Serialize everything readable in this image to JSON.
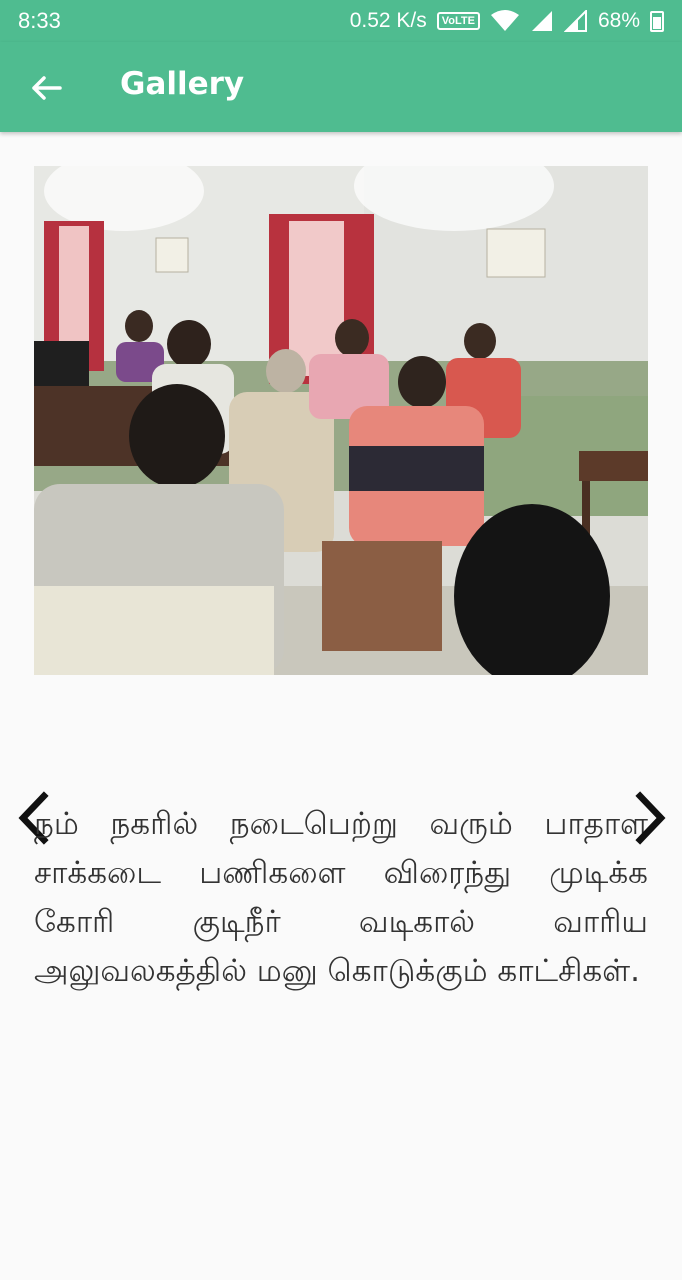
{
  "status_bar": {
    "time": "8:33",
    "net_speed": "0.52 K/s",
    "volte": "VoLTE",
    "battery": "68%"
  },
  "app_bar": {
    "title": "Gallery",
    "back_icon": "arrow-left-icon"
  },
  "gallery": {
    "image_alt": "Photo of people seated in an office meeting",
    "caption": "நம் நகரில் நடைபெற்று வரும் பாதாள சாக்கடை பணிகளை விரைந்து முடிக்க கோரி குடிநீர் வடிகால் வாரிய அலுவலகத்தில் மனு கொடுக்கும் காட்சிகள்.",
    "prev_icon": "chevron-left-icon",
    "next_icon": "chevron-right-icon"
  },
  "colors": {
    "primary": "#4fbc90",
    "background": "#fafafa"
  }
}
